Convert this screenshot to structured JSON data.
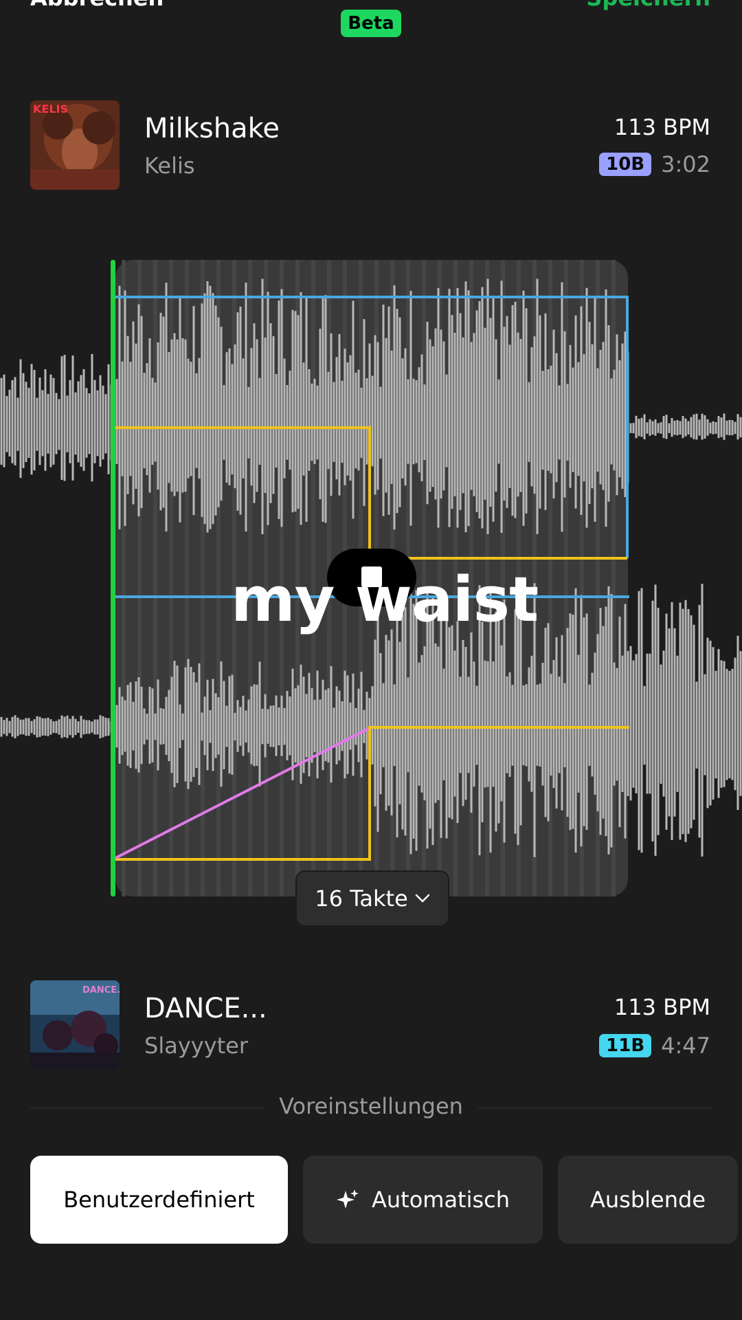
{
  "header": {
    "cancel_label": "Abbrechen",
    "save_label": "Speichern",
    "beta_label": "Beta"
  },
  "track_top": {
    "title": "Milkshake",
    "artist": "Kelis",
    "bpm": "113 BPM",
    "key": "10B",
    "key_color": "#9aa0ff",
    "duration": "3:02",
    "cover_text": "KELIS"
  },
  "editor": {
    "lyric": "my waist",
    "bars_label": "16 Takte",
    "playhead_color": "#22d13f",
    "upper_curve_color": "#4aa8e0",
    "lower_curve_color": "#f0c21b",
    "ramp_color": "#e07ae8"
  },
  "track_bottom": {
    "title": "DANCE...",
    "artist": "Slayyyter",
    "bpm": "113 BPM",
    "key": "11B",
    "key_color": "#45d6f0",
    "duration": "4:47",
    "cover_text": "DANCE..."
  },
  "presets": {
    "label": "Voreinstellungen",
    "options": [
      "Benutzerdefiniert",
      "Automatisch",
      "Ausblende"
    ],
    "selected": "Benutzerdefiniert"
  }
}
